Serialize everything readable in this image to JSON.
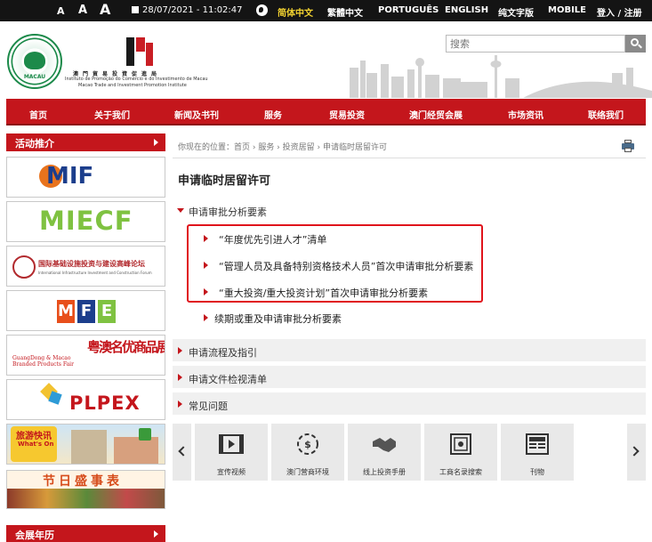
{
  "topbar": {
    "font_sizes": [
      "A",
      "A",
      "A"
    ],
    "datetime": "28/07/2021 - 11:02:47",
    "languages": [
      {
        "label": "简体中文",
        "active": true
      },
      {
        "label": "繁體中文",
        "active": false
      },
      {
        "label": "PORTUGUÊS",
        "active": false
      },
      {
        "label": "ENGLISH",
        "active": false
      },
      {
        "label": "纯文字版",
        "active": false
      },
      {
        "label": "MOBILE",
        "active": false
      }
    ],
    "login": "登入 / 注册"
  },
  "header": {
    "emblem_text": "MACAU",
    "org_name_cn": "澳門貿易投資促進局",
    "org_name_pt": "Instituto de Promoção do Comércio e do Investimento de Macau",
    "org_name_en": "Macao Trade and Investment Promotion Institute",
    "search_placeholder": "搜索"
  },
  "nav": {
    "items": [
      "首页",
      "关于我们",
      "新闻及书刊",
      "服务",
      "贸易投资",
      "澳门经贸会展",
      "市场资讯",
      "联络我们"
    ]
  },
  "sidebar": {
    "activities_title": "活动推介",
    "expo_title": "会展年历",
    "banners": [
      {
        "name": "MIF",
        "text": "MIF"
      },
      {
        "name": "MIECF",
        "text": "MIECF"
      },
      {
        "name": "IIICF",
        "text": "国际基础设施投资与建设高峰论坛",
        "sub": "International Infrastructure Investment and Construction Forum"
      },
      {
        "name": "MFE",
        "text": "MFE"
      },
      {
        "name": "GDMBPF",
        "text": "粤澳名优商品展",
        "sub": "GuangDong & Macao Branded Products Fair"
      },
      {
        "name": "PLPEX",
        "text": "PLPEX"
      },
      {
        "name": "whats-on",
        "text": "旅游快讯",
        "sub": "What's On"
      },
      {
        "name": "festivals",
        "text": "节日盛事表"
      }
    ]
  },
  "main": {
    "breadcrumb": "你现在的位置：首页 › 服务 › 投资居留 › 申请临时居留许可",
    "title": "申请临时居留许可",
    "section1": "申请审批分析要素",
    "sub_items": [
      "“年度优先引进人才”清单",
      "“管理人员及具备特别资格技术人员”首次申请审批分析要素",
      "“重大投资/重大投资计划”首次申请审批分析要素",
      "续期或重及申请审批分析要素"
    ],
    "accordion": [
      "申请流程及指引",
      "申请文件检视清单",
      "常见问题"
    ]
  },
  "carousel": {
    "items": [
      {
        "label": "宣传视频",
        "icon": "film-icon"
      },
      {
        "label": "澳门营商环境",
        "icon": "currency-icon"
      },
      {
        "label": "线上投资手册",
        "icon": "handshake-icon"
      },
      {
        "label": "工商名录搜索",
        "icon": "safe-icon"
      },
      {
        "label": "刊物",
        "icon": "news-icon"
      }
    ]
  },
  "colors": {
    "brand_red": "#c4161c",
    "topbar_bg": "#141414",
    "active_lang": "#f2d230"
  }
}
